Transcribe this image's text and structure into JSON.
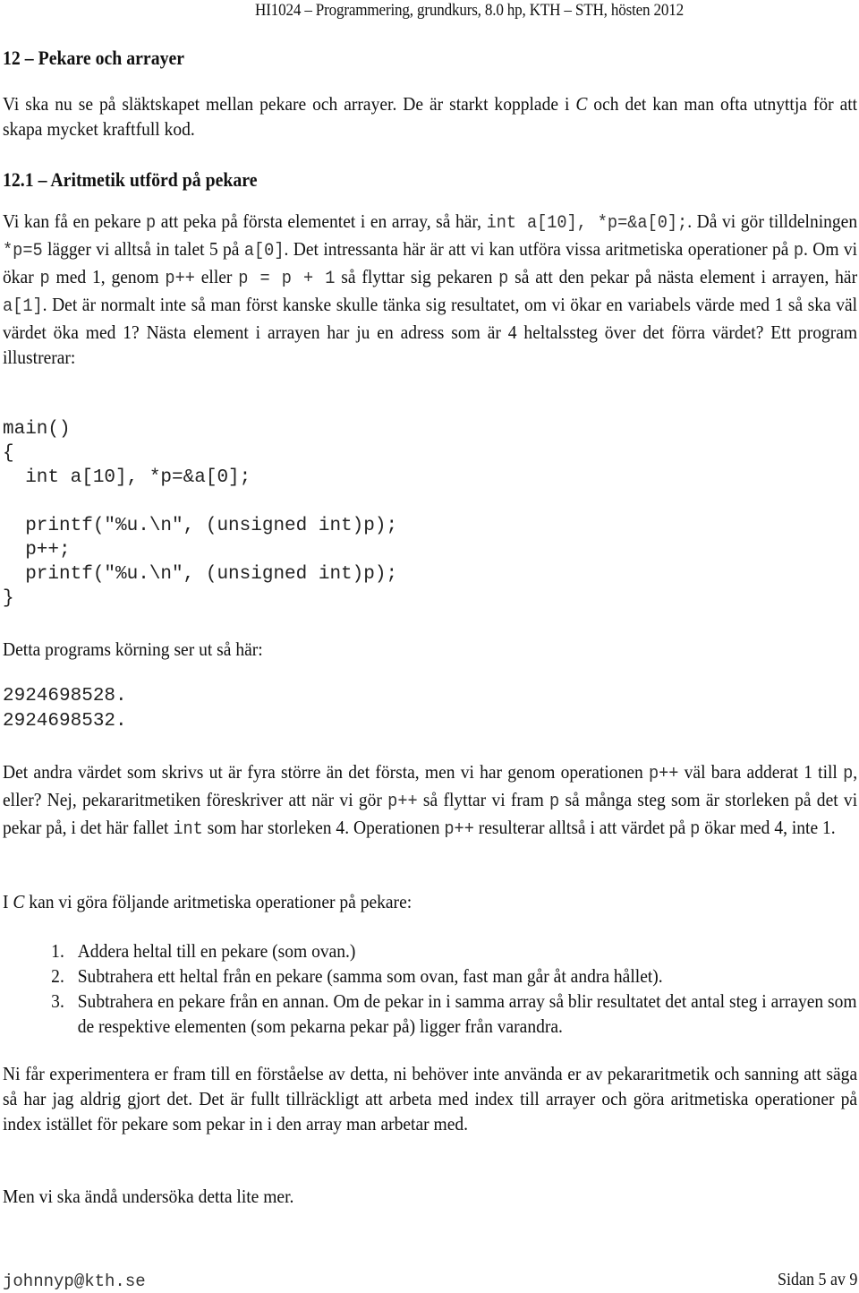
{
  "header": {
    "running_title": "HI1024 – Programmering, grundkurs, 8.0 hp, KTH – STH, hösten 2012"
  },
  "section": {
    "title": "12 – Pekare och arrayer",
    "intro": [
      {
        "t": "Vi ska nu se på släktskapet mellan pekare och arrayer. De är starkt kopplade i "
      },
      {
        "t": "C",
        "style": "ital"
      },
      {
        "t": " och det kan man ofta utnyttja för att skapa mycket kraftfull kod."
      }
    ]
  },
  "subsection": {
    "title": "12.1 – Aritmetik utförd på pekare",
    "paragraph1": [
      {
        "t": "Vi kan få en pekare "
      },
      {
        "t": "p",
        "style": "code"
      },
      {
        "t": " att peka på första elementet i en array, så här, "
      },
      {
        "t": "int a[10], *p=&a[0];",
        "style": "code"
      },
      {
        "t": ". Då vi gör tilldelningen "
      },
      {
        "t": "*p=5",
        "style": "code"
      },
      {
        "t": " lägger vi alltså in talet 5 på "
      },
      {
        "t": "a[0]",
        "style": "code"
      },
      {
        "t": ". Det intressanta här är att vi kan utföra vissa aritmetiska operationer på "
      },
      {
        "t": "p",
        "style": "code"
      },
      {
        "t": ". Om vi ökar "
      },
      {
        "t": "p",
        "style": "code"
      },
      {
        "t": " med 1, genom "
      },
      {
        "t": "p++",
        "style": "code"
      },
      {
        "t": " eller "
      },
      {
        "t": "p = p + 1",
        "style": "code"
      },
      {
        "t": " så flyttar sig pekaren "
      },
      {
        "t": "p",
        "style": "code"
      },
      {
        "t": " så att den pekar på nästa element i arrayen, här "
      },
      {
        "t": "a[1]",
        "style": "code"
      },
      {
        "t": ". Det är normalt inte så man först kanske skulle tänka sig resultatet, om vi ökar en variabels värde med 1 så ska väl värdet öka med 1? Nästa element i arrayen har ju en adress som är 4 heltalssteg över det förra värdet? Ett program illustrerar:"
      }
    ],
    "code_lines": [
      "main()",
      "{",
      "  int a[10], *p=&a[0];",
      "",
      "  printf(\"%u.\\n\", (unsigned int)p);",
      "  p++;",
      "  printf(\"%u.\\n\", (unsigned int)p);",
      "}"
    ],
    "run_intro": [
      {
        "t": "Detta programs körning ser ut så här:"
      }
    ],
    "output_lines": [
      "2924698528.",
      "2924698532."
    ],
    "paragraph2": [
      {
        "t": "Det andra värdet som skrivs ut är fyra större än det första, men vi har genom operationen "
      },
      {
        "t": "p++",
        "style": "code"
      },
      {
        "t": " väl bara adderat 1 till "
      },
      {
        "t": "p",
        "style": "code"
      },
      {
        "t": ", eller? Nej, pekararitmetiken föreskriver att när vi gör "
      },
      {
        "t": "p++",
        "style": "code"
      },
      {
        "t": " så flyttar vi fram "
      },
      {
        "t": "p",
        "style": "code"
      },
      {
        "t": " så många steg som är storleken på det vi pekar på, i det här fallet "
      },
      {
        "t": "int",
        "style": "code"
      },
      {
        "t": " som har storleken 4. Operationen "
      },
      {
        "t": "p++",
        "style": "code"
      },
      {
        "t": " resulterar alltså i att värdet på "
      },
      {
        "t": "p",
        "style": "code"
      },
      {
        "t": " ökar med 4, inte 1."
      }
    ],
    "ops_intro": [
      {
        "t": "I "
      },
      {
        "t": "C",
        "style": "ital"
      },
      {
        "t": " kan vi göra följande aritmetiska operationer på pekare:"
      }
    ],
    "ops_list": [
      {
        "num": "1.",
        "text": "Addera heltal till en pekare (som ovan.)"
      },
      {
        "num": "2.",
        "text": "Subtrahera ett heltal från en pekare (samma som ovan, fast man går åt andra hållet)."
      },
      {
        "num": "3.",
        "text": "Subtrahera en pekare från en annan. Om de pekar in i samma array så blir resultatet det antal steg i arrayen som de respektive elementen (som pekarna pekar på) ligger från varandra."
      }
    ],
    "paragraph3": [
      {
        "t": "Ni får experimentera er fram till en förståelse av detta, ni behöver inte använda er av pekararitmetik och sanning att säga så har jag aldrig gjort det. Det är fullt tillräckligt att arbeta med index till arrayer och göra aritmetiska operationer på index istället för pekare som pekar in i den array man arbetar med."
      }
    ],
    "paragraph4": [
      {
        "t": "Men vi ska ändå undersöka detta lite mer."
      }
    ]
  },
  "footer": {
    "email": "johnnyp@kth.se",
    "page_label": "Sidan 5 av 9"
  }
}
